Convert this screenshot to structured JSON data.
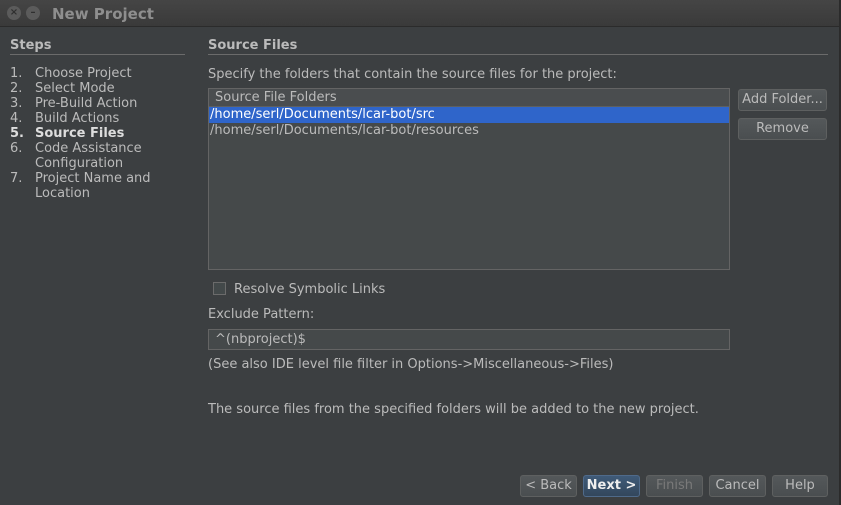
{
  "window": {
    "title": "New Project",
    "close_icon": "×",
    "minimize_icon": "–"
  },
  "steps": {
    "heading": "Steps",
    "items": [
      {
        "num": "1.",
        "label": "Choose Project"
      },
      {
        "num": "2.",
        "label": "Select Mode"
      },
      {
        "num": "3.",
        "label": "Pre-Build Action"
      },
      {
        "num": "4.",
        "label": "Build Actions"
      },
      {
        "num": "5.",
        "label": "Source Files"
      },
      {
        "num": "6.",
        "label": "Code Assistance Configuration"
      },
      {
        "num": "7.",
        "label": "Project Name and Location"
      }
    ],
    "current_index": 4
  },
  "panel": {
    "heading": "Source Files",
    "instruction": "Specify the folders that contain the source files for the project:",
    "list_header": "Source File Folders",
    "folders": [
      "/home/serl/Documents/lcar-bot/src",
      "/home/serl/Documents/lcar-bot/resources"
    ],
    "selected_folder_index": 0,
    "add_folder_label": "Add Folder...",
    "remove_label": "Remove",
    "resolve_symlinks_label": "Resolve Symbolic Links",
    "resolve_symlinks_checked": false,
    "exclude_pattern_label": "Exclude Pattern:",
    "exclude_pattern_value": "^(nbproject)$",
    "ide_filter_note": "(See also IDE level file filter in Options->Miscellaneous->Files)",
    "info_text": "The source files from the specified folders will be added to the new project."
  },
  "footer": {
    "back_label": "< Back",
    "next_label": "Next >",
    "finish_label": "Finish",
    "cancel_label": "Cancel",
    "help_label": "Help"
  }
}
